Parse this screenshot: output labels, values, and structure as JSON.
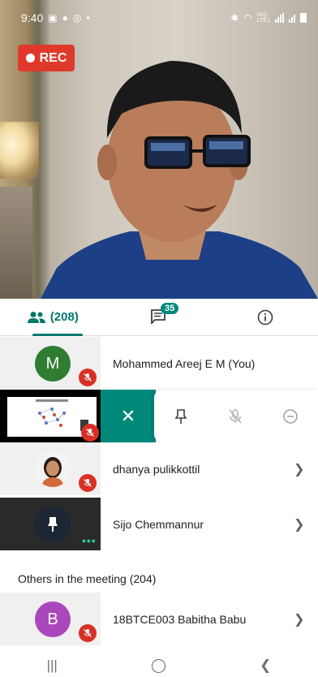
{
  "status_bar": {
    "time": "9:40",
    "carrier_label": "Vo))\nLTE1"
  },
  "video": {
    "rec_label": "REC"
  },
  "tabs": {
    "people_count": "(208)",
    "chat_count": "35"
  },
  "participants": [
    {
      "initial": "M",
      "avatar_color": "#2e7d32",
      "name": "Mohammed Areej E M (You)",
      "muted": true
    },
    {
      "selected": true,
      "muted": true
    },
    {
      "name": "dhanya pulikkottil",
      "muted": true
    },
    {
      "name": "Sijo Chemmannur",
      "pinned": true
    }
  ],
  "others": {
    "header": "Others in the meeting (204)",
    "items": [
      {
        "initial": "B",
        "avatar_color": "#ab47bc",
        "name": "18BTCE003 Babitha Babu",
        "muted": true
      }
    ]
  },
  "colors": {
    "accent": "#00897b",
    "rec": "#e0392b",
    "mute": "#d93025"
  }
}
